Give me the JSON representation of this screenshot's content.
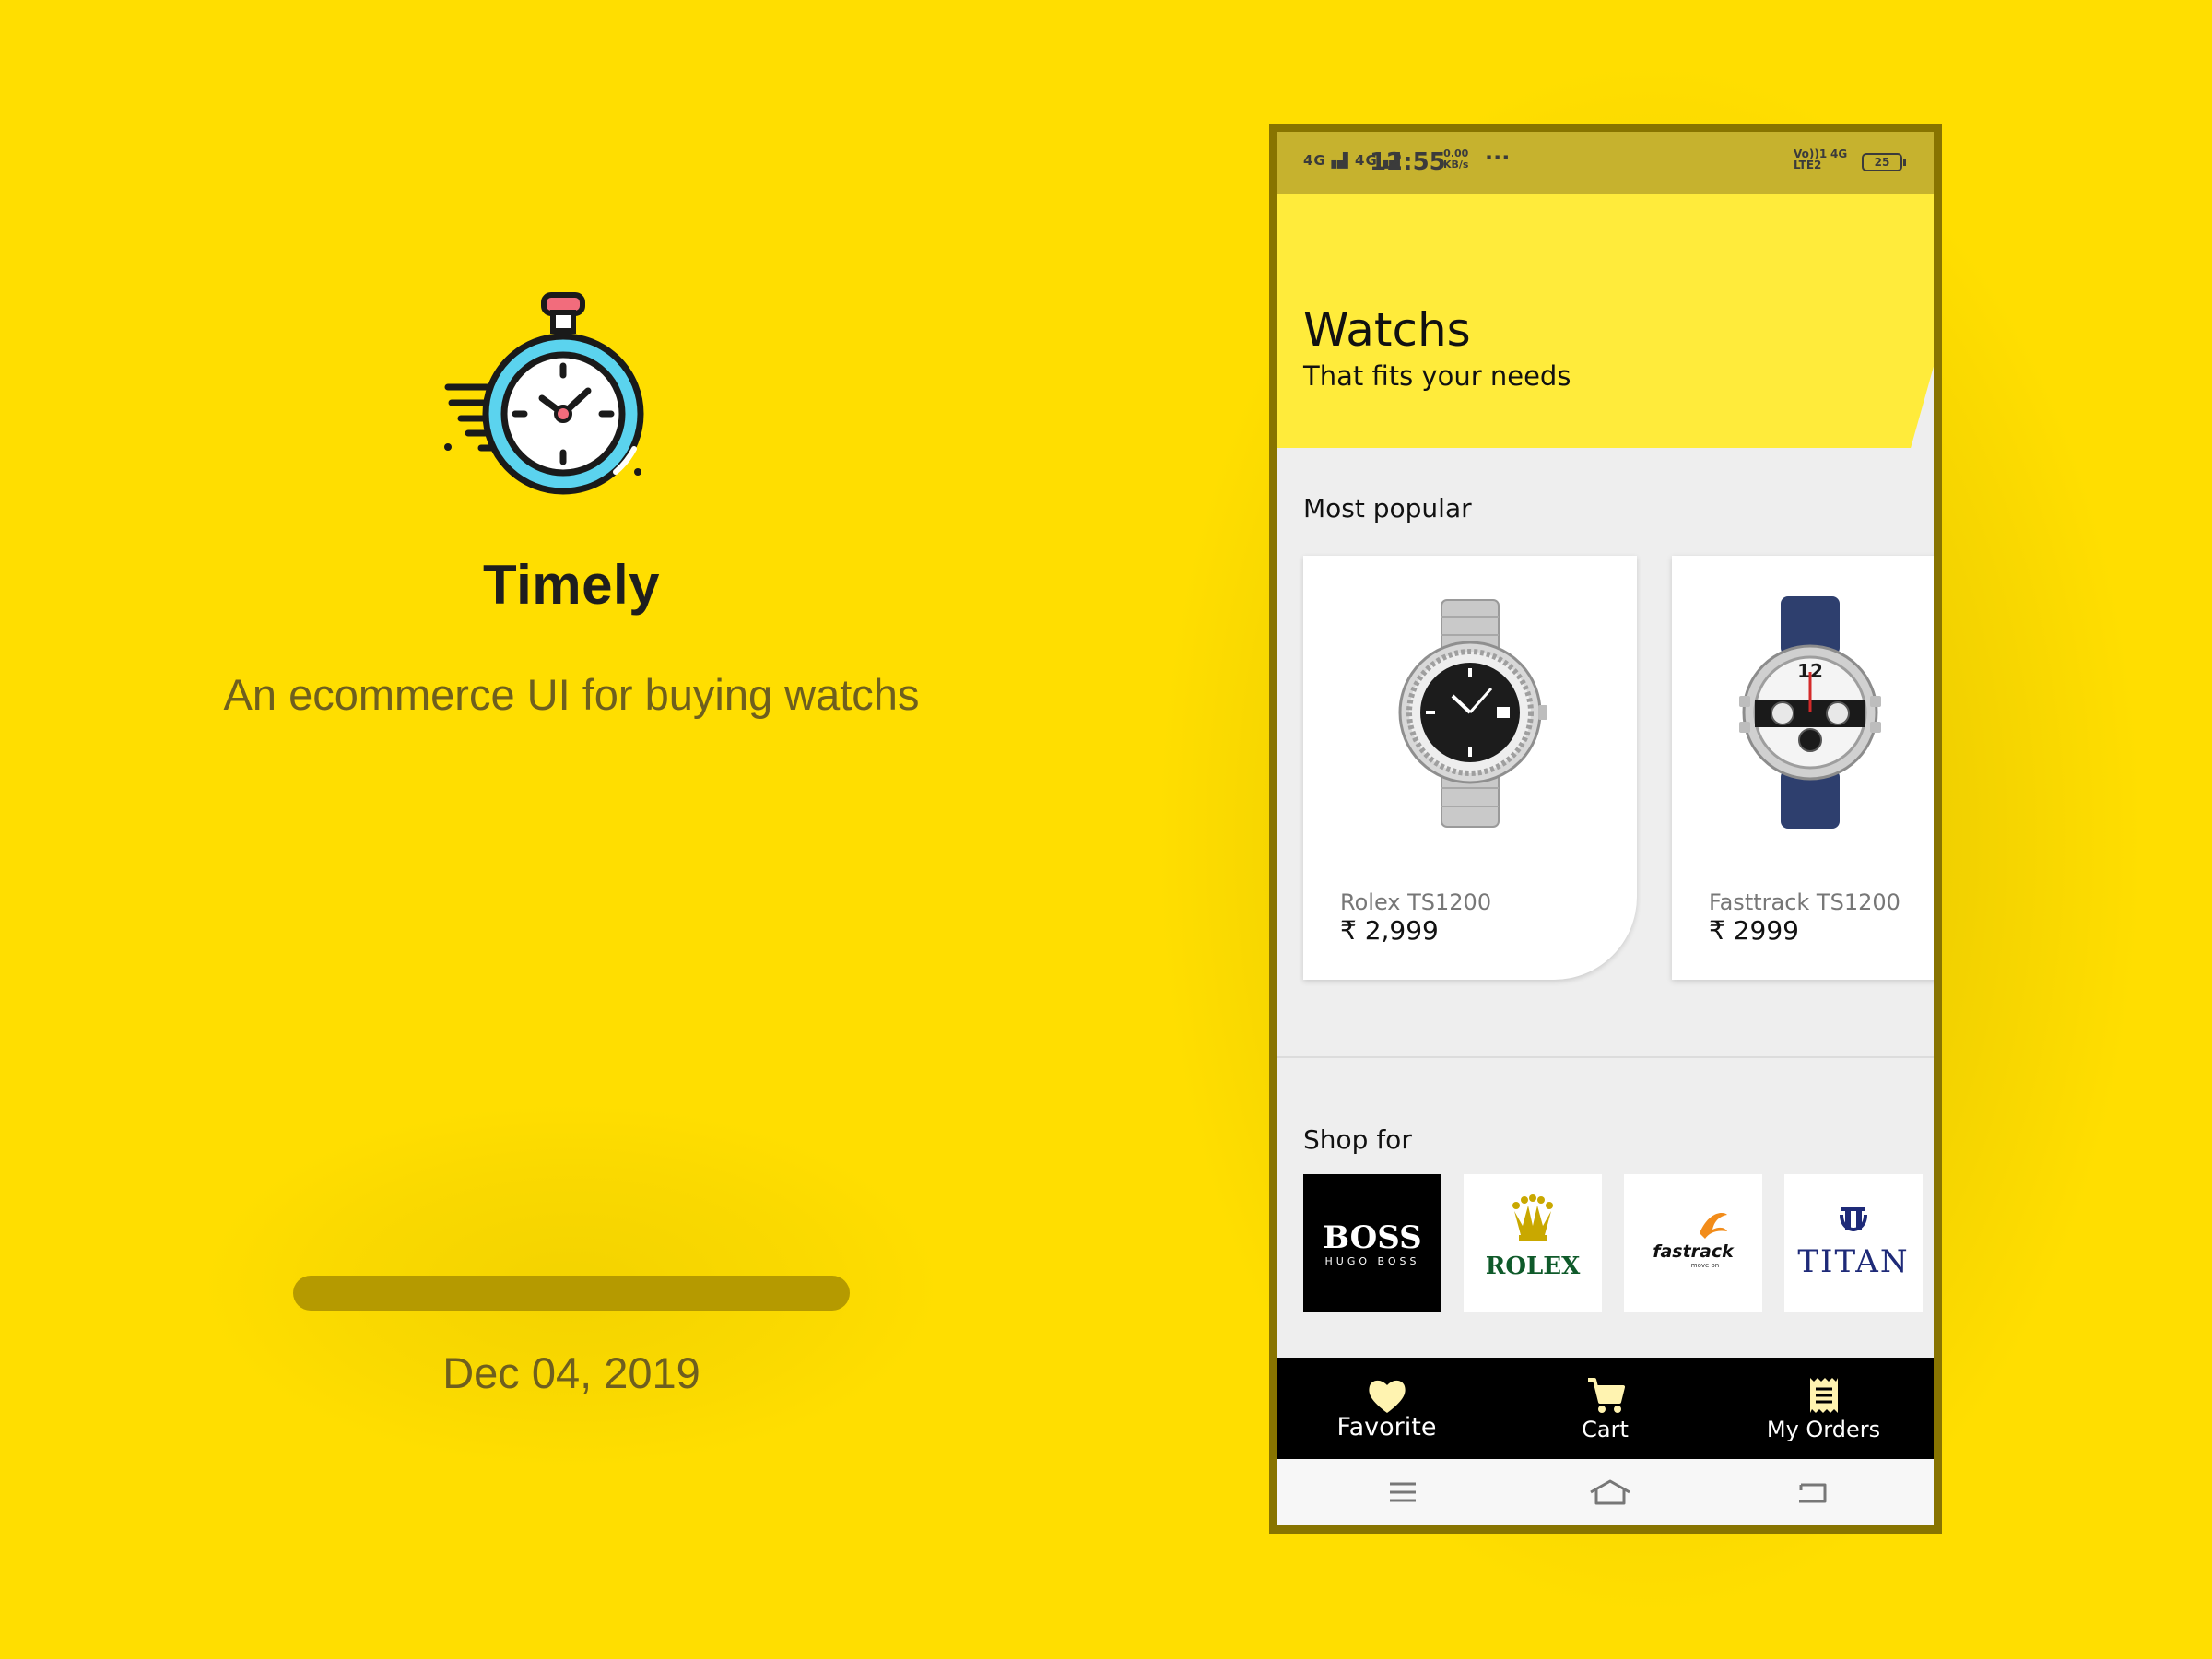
{
  "app": {
    "title": "Timely",
    "subtitle": "An ecommerce UI for buying watchs",
    "date": "Dec 04, 2019",
    "progress": 1.0,
    "logo_icon": "stopwatch-icon"
  },
  "colors": {
    "background": "#FFDE00",
    "header_band": "#FFEB3B",
    "progress_track": "#B59A00",
    "bottom_nav": "#000000",
    "phone_frame": "#887400"
  },
  "status_bar": {
    "signal_1": "4G",
    "signal_2": "4G",
    "time": "12:55",
    "speed_value": "0.00",
    "speed_unit": "KB/s",
    "more": "···",
    "volte": "Vo))1",
    "lte": "LTE2",
    "net_right": "4G",
    "battery": "25"
  },
  "header": {
    "title": "Watchs",
    "subtitle": "That fits your needs"
  },
  "popular": {
    "label": "Most popular",
    "products": [
      {
        "name": "Rolex TS1200",
        "price": "₹ 2,999",
        "image_icon": "rolex-watch-image"
      },
      {
        "name": "Fasttrack TS1200",
        "price": "₹ 2999",
        "image_icon": "fastrack-watch-image"
      }
    ]
  },
  "shop_for": {
    "label": "Shop for",
    "brands": [
      {
        "name": "BOSS",
        "tagline": "HUGO BOSS"
      },
      {
        "name": "ROLEX"
      },
      {
        "name": "fastrack",
        "tagline": "move on"
      },
      {
        "name": "TITAN"
      }
    ]
  },
  "bottom_nav": {
    "items": [
      {
        "label": "Favorite",
        "icon": "heart-icon"
      },
      {
        "label": "Cart",
        "icon": "cart-icon"
      },
      {
        "label": "My Orders",
        "icon": "receipt-icon"
      }
    ]
  },
  "system_nav": {
    "icons": [
      "menu-icon",
      "home-icon",
      "back-icon"
    ]
  }
}
